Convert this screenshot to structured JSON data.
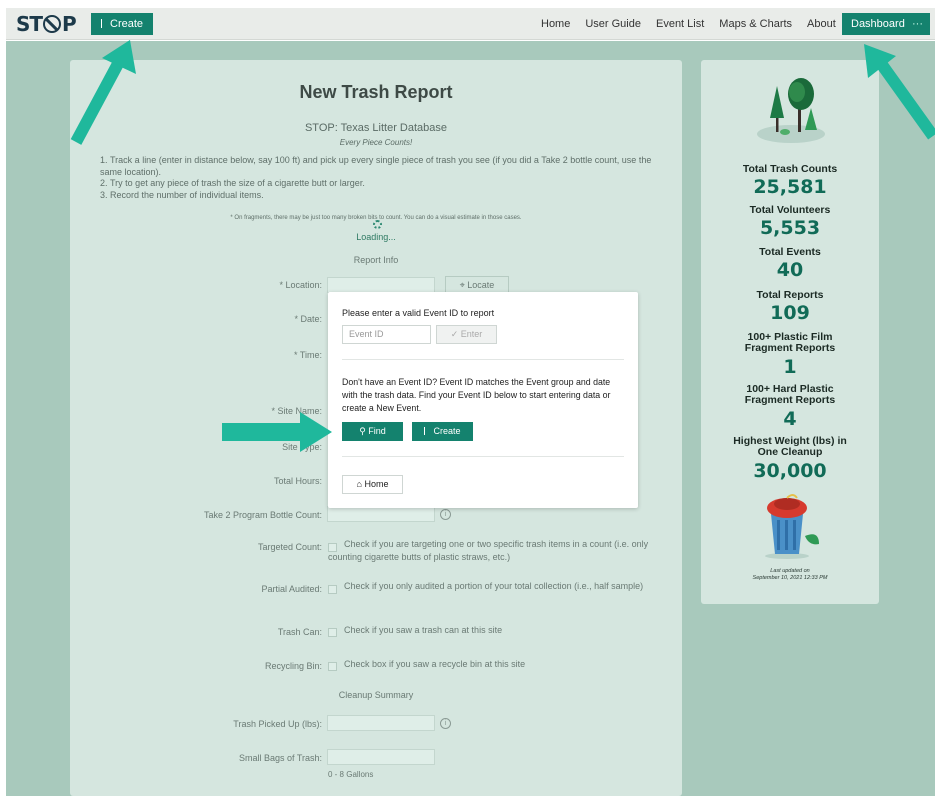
{
  "nav": {
    "logo": "STOP",
    "create_label": "Create",
    "links": [
      "Home",
      "User Guide",
      "Event List",
      "Maps & Charts",
      "About"
    ],
    "dashboard_label": "Dashboard",
    "more_label": "···"
  },
  "form": {
    "title": "New Trash Report",
    "subtitle": "STOP: Texas Litter Database",
    "tagline": "Every Piece Counts!",
    "steps": [
      "Track a line (enter in distance below, say 100 ft) and pick up every single piece of trash you see (if you did a Take 2 bottle count, use the same location).",
      "Try to get any piece of trash the size of a cigarette butt or larger.",
      "Record the number of individual items."
    ],
    "note": "* On fragments, there may be just too many broken bits to count. You can do a visual estimate in those cases.",
    "loading": "Loading...",
    "section_report_info": "Report Info",
    "location_label": "* Location:",
    "locate_label": "Locate",
    "date_label": "* Date:",
    "time_label": "* Time:",
    "site_name_label": "* Site Name:",
    "site_type_label": "Site Type:",
    "total_hours_label": "Total Hours:",
    "take2_label": "Take 2 Program Bottle Count:",
    "targeted_label": "Targeted Count:",
    "targeted_text": "Check if you are targeting one or two specific trash items in a count (i.e. only counting cigarette butts of plastic straws, etc.)",
    "partial_label": "Partial Audited:",
    "partial_text": "Check if you only audited a portion of your total collection (i.e., half sample)",
    "trash_can_label": "Trash Can:",
    "trash_can_text": "Check if you saw a trash can at this site",
    "recycling_label": "Recycling Bin:",
    "recycling_text": "Check box if you saw a recycle bin at this site",
    "section_cleanup": "Cleanup Summary",
    "trash_picked_label": "Trash Picked Up (lbs):",
    "small_bags_label": "Small Bags of Trash:",
    "small_bags_hint": "0 - 8 Gallons"
  },
  "stats": {
    "items": [
      {
        "label": "Total Trash Counts",
        "value": "25,581"
      },
      {
        "label": "Total Volunteers",
        "value": "5,553"
      },
      {
        "label": "Total Events",
        "value": "40"
      },
      {
        "label": "Total Reports",
        "value": "109"
      },
      {
        "label": "100+ Plastic Film Fragment Reports",
        "value": "1"
      },
      {
        "label": "100+ Hard Plastic Fragment Reports",
        "value": "4"
      },
      {
        "label": "Highest Weight (lbs) in One Cleanup",
        "value": "30,000"
      }
    ],
    "updated_line1": "Last updated on",
    "updated_line2": "September 10, 2021 12:33 PM"
  },
  "modal": {
    "prompt": "Please enter a valid Event ID to report",
    "event_id_placeholder": "Event ID",
    "enter_label": "Enter",
    "description": "Don't have an Event ID? Event ID matches the Event group and date with the trash data. Find your Event ID below to start entering data or create a New Event.",
    "find_label": "Find",
    "create_label": "Create",
    "home_label": "Home"
  },
  "colors": {
    "primary": "#14826e",
    "stat_value": "#116b57",
    "arrow": "#1fb89c",
    "backdrop": "#a8c9bc"
  }
}
